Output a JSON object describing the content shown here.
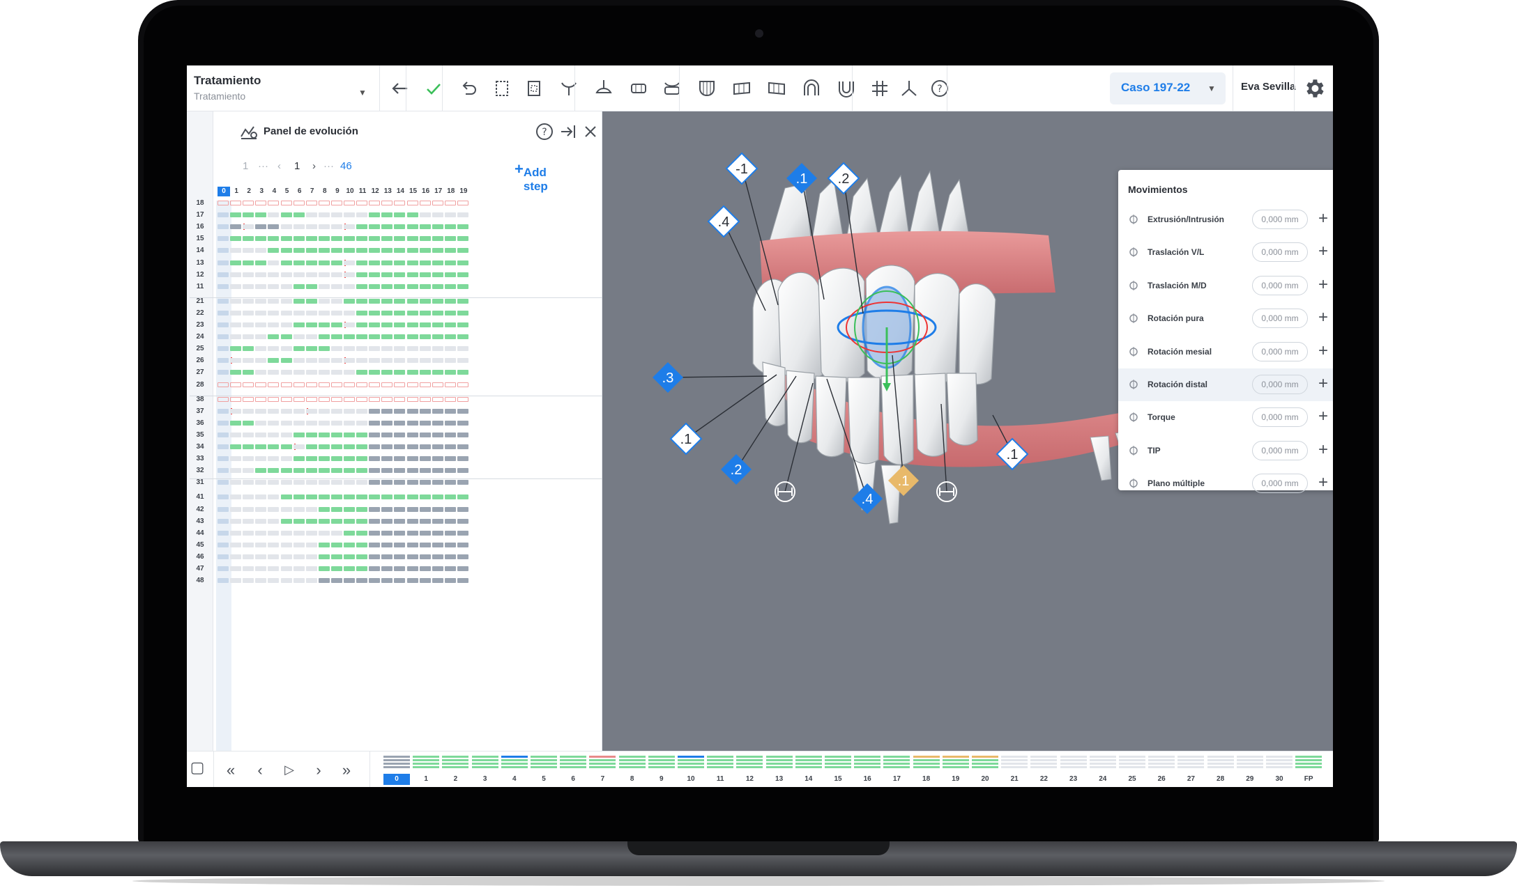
{
  "header": {
    "mode_title": "Tratamiento",
    "mode_subtitle": "Tratamiento",
    "case_label": "Caso 197-22",
    "user_name": "Eva Sevilla"
  },
  "toolbar": {
    "icons": [
      "back-arrow-icon",
      "check-icon",
      "undo-icon",
      "crop-icon",
      "crop-alt-icon",
      "upper-arch-icon",
      "lower-arch-icon",
      "tooth-row-icon",
      "tooth-row-alt-icon",
      "molar-icon",
      "molar-grid-icon",
      "molar-grid-alt-icon",
      "arch-upper-icon",
      "arch-lower-icon",
      "grid-icon",
      "axis-icon",
      "help-icon"
    ]
  },
  "panel": {
    "title": "Panel de evolución",
    "pager": {
      "first": "1",
      "ellipsis": "···",
      "current": "1",
      "last": "46"
    },
    "add_step_label": "Add step",
    "columns": [
      "0",
      "1",
      "2",
      "3",
      "4",
      "5",
      "6",
      "7",
      "8",
      "9",
      "10",
      "11",
      "12",
      "13",
      "14",
      "15",
      "16",
      "17",
      "18",
      "19"
    ],
    "rows": [
      "18",
      "17",
      "16",
      "15",
      "14",
      "13",
      "12",
      "11",
      "21",
      "22",
      "23",
      "24",
      "25",
      "26",
      "27",
      "28",
      "38",
      "37",
      "36",
      "35",
      "34",
      "33",
      "32",
      "31",
      "41",
      "42",
      "43",
      "44",
      "45",
      "46",
      "47",
      "48"
    ]
  },
  "movements": {
    "title": "Movimientos",
    "items": [
      {
        "label": "Extrusión/Intrusión",
        "value": "0,000 mm"
      },
      {
        "label": "Traslación V/L",
        "value": "0,000 mm"
      },
      {
        "label": "Traslación M/D",
        "value": "0,000 mm"
      },
      {
        "label": "Rotación pura",
        "value": "0,000 mm"
      },
      {
        "label": "Rotación mesial",
        "value": "0,000 mm"
      },
      {
        "label": "Rotación distal",
        "value": "0,000 mm"
      },
      {
        "label": "Torque",
        "value": "0,000 mm"
      },
      {
        "label": "TIP",
        "value": "0,000 mm"
      },
      {
        "label": "Plano múltiple",
        "value": "0,000 mm"
      }
    ],
    "plus_glyph": "+",
    "minus_glyph": "—"
  },
  "markers": [
    {
      "label": "-1",
      "style": "white"
    },
    {
      "label": ".1",
      "style": "blue"
    },
    {
      "label": ".2",
      "style": "white"
    },
    {
      "label": ".4",
      "style": "white"
    },
    {
      "label": ".3",
      "style": "blue"
    },
    {
      "label": ".1",
      "style": "white"
    },
    {
      "label": ".2",
      "style": "blue"
    },
    {
      "label": ".4",
      "style": "blue"
    },
    {
      "label": ".1",
      "style": "orange"
    },
    {
      "label": ".1",
      "style": "white"
    }
  ],
  "timeline": {
    "steps": [
      "0",
      "1",
      "2",
      "3",
      "4",
      "5",
      "6",
      "7",
      "8",
      "9",
      "10",
      "11",
      "12",
      "13",
      "14",
      "15",
      "16",
      "17",
      "18",
      "19",
      "20",
      "21",
      "22",
      "23",
      "24",
      "25",
      "26",
      "27",
      "28",
      "29",
      "30",
      "FP"
    ],
    "active_step": "0"
  },
  "colors": {
    "accent": "#1e7de8",
    "moving": "#7ed99a",
    "finished": "#9aa4b1",
    "idle": "#e2e5ea",
    "warning": "#e8b96a",
    "viewer_bg": "#767b85"
  }
}
